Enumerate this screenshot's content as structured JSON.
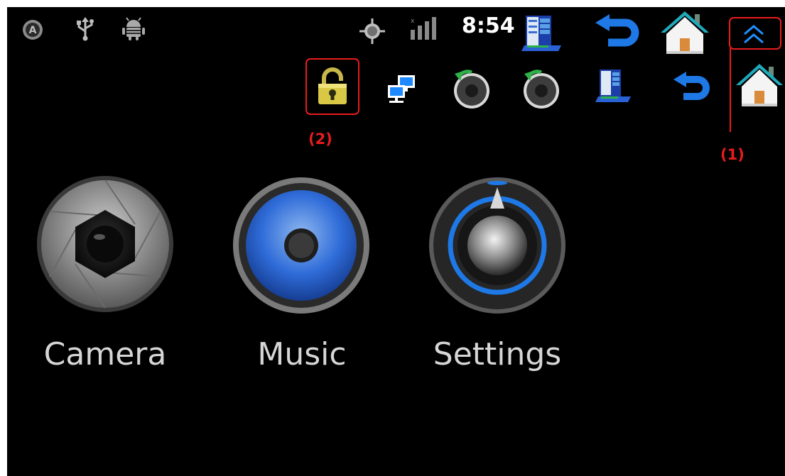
{
  "status_bar": {
    "clock": "8:54",
    "left_icons": [
      "gps-a-icon",
      "usb-icon",
      "android-debug-icon"
    ],
    "right_icons": [
      "gps-target-icon",
      "signal-bars-icon",
      "overflow-window-icon",
      "back-arrow-icon",
      "home-icon",
      "expand-chevron-icon"
    ]
  },
  "notification_row": {
    "icons": [
      "unlock-icon",
      "network-icon",
      "speaker-refresh-icon",
      "speaker-refresh-icon",
      "overflow-window-icon",
      "back-arrow-icon",
      "home-icon"
    ]
  },
  "apps": [
    {
      "label": "Camera",
      "icon": "camera-aperture-icon"
    },
    {
      "label": "Music",
      "icon": "speaker-icon"
    },
    {
      "label": "Settings",
      "icon": "settings-knob-icon"
    }
  ],
  "annotations": {
    "label_1": "(1)",
    "label_2": "(2)"
  },
  "colors": {
    "background": "#000000",
    "annotation": "#e81c1c",
    "accent_blue": "#1e78e6",
    "label_text": "#d6d6d6"
  }
}
